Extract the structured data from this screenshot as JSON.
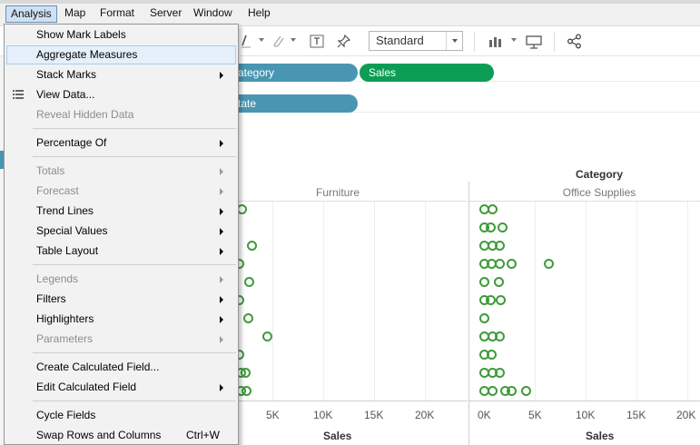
{
  "menubar": {
    "items": [
      "Analysis",
      "Map",
      "Format",
      "Server",
      "Window",
      "Help"
    ]
  },
  "toolbar": {
    "fit_select": "Standard",
    "icons": [
      "pen-icon",
      "paperclip-icon",
      "text-box-icon",
      "pin-icon",
      "show-me-icon",
      "presentation-icon",
      "share-icon"
    ]
  },
  "shelves": {
    "columns_pills": [
      "Category",
      "Sales"
    ],
    "rows_pills": [
      "State"
    ],
    "columns_pill_visible": [
      "ategory",
      "Sales"
    ],
    "rows_pill_visible": [
      "tate"
    ]
  },
  "view": {
    "category_title": "Category",
    "headers": [
      "Furniture",
      "Office Supplies"
    ],
    "furniture_ticks": [
      "5K",
      "10K",
      "15K",
      "20K"
    ],
    "office_ticks": [
      "0K",
      "5K",
      "10K",
      "15K",
      "20K"
    ],
    "axis_titles": [
      "Sales",
      "Sales"
    ],
    "mark_color": "#3f9b3b"
  },
  "menu": {
    "items": [
      {
        "label": "Show Mark Labels",
        "enabled": true
      },
      {
        "label": "Aggregate Measures",
        "enabled": true,
        "hover": true
      },
      {
        "label": "Stack Marks",
        "enabled": true,
        "submenu": true
      },
      {
        "label": "View Data...",
        "enabled": true,
        "icon": "table-icon"
      },
      {
        "label": "Reveal Hidden Data",
        "enabled": false
      },
      {
        "label": "Percentage Of",
        "enabled": true,
        "submenu": true
      },
      {
        "label": "Totals",
        "enabled": false,
        "submenu": true
      },
      {
        "label": "Forecast",
        "enabled": false,
        "submenu": true
      },
      {
        "label": "Trend Lines",
        "enabled": true,
        "submenu": true
      },
      {
        "label": "Special Values",
        "enabled": true,
        "submenu": true
      },
      {
        "label": "Table Layout",
        "enabled": true,
        "submenu": true
      },
      {
        "label": "Legends",
        "enabled": false,
        "submenu": true
      },
      {
        "label": "Filters",
        "enabled": true,
        "submenu": true
      },
      {
        "label": "Highlighters",
        "enabled": true,
        "submenu": true
      },
      {
        "label": "Parameters",
        "enabled": false,
        "submenu": true
      },
      {
        "label": "Create Calculated Field...",
        "enabled": true
      },
      {
        "label": "Edit Calculated Field",
        "enabled": true,
        "submenu": true
      },
      {
        "label": "Cycle Fields",
        "enabled": true
      },
      {
        "label": "Swap Rows and Columns",
        "enabled": true,
        "shortcut": "Ctrl+W"
      }
    ]
  }
}
